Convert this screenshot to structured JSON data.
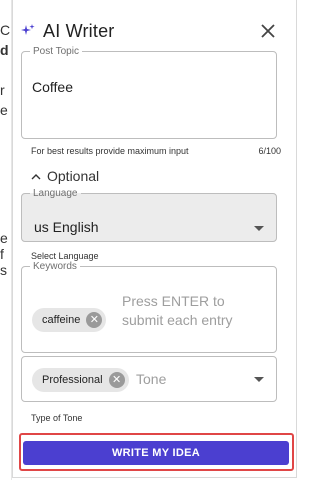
{
  "background_fragments": [
    "C",
    "d",
    "r",
    "e",
    "e",
    "f",
    "s"
  ],
  "writer": {
    "title": "AI Writer",
    "post_topic": {
      "label": "Post Topic",
      "value": "Coffee",
      "helper": "For best results provide maximum input",
      "counter": "6/100"
    },
    "optional_label": "Optional",
    "language": {
      "label": "Language",
      "value": "us English",
      "helper": "Select Language"
    },
    "keywords": {
      "label": "Keywords",
      "chips": [
        "caffeine"
      ],
      "placeholder": "Press ENTER to submit each entry"
    },
    "tone": {
      "chips": [
        "Professional"
      ],
      "placeholder": "Tone",
      "helper": "Type of Tone"
    },
    "cta_label": "WRITE MY IDEA"
  },
  "colors": {
    "accent": "#4b3fd0",
    "highlight_border": "#e04646"
  },
  "icons": {
    "logo": "sparkle-icon",
    "close": "close-icon",
    "collapse": "chevron-up-icon",
    "dropdown": "caret-down-icon",
    "chip_remove": "remove-chip-icon"
  }
}
